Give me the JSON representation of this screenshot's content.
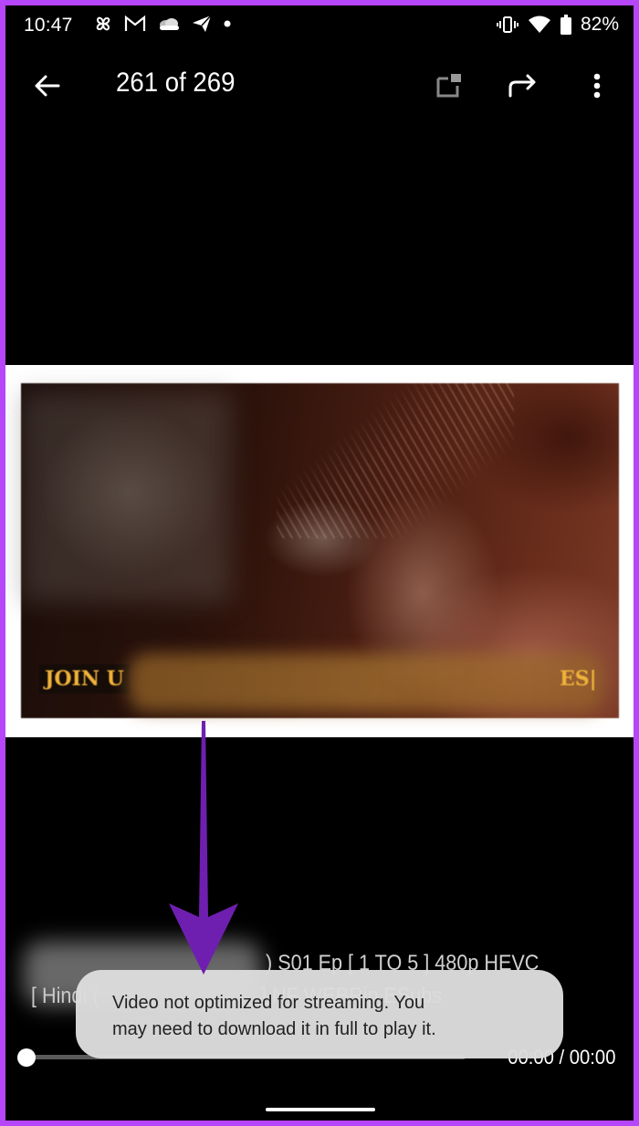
{
  "status_bar": {
    "time": "10:47",
    "notification_icons": [
      "pinwheel-icon",
      "gmail-icon",
      "onedrive-cloud-icon",
      "telegram-icon",
      "more-notifications-dot-icon"
    ],
    "system_icons": [
      "vibrate-icon",
      "wifi-icon",
      "battery-icon"
    ],
    "battery_percent": "82%"
  },
  "toolbar": {
    "back_icon": "arrow-left-icon",
    "counter": "261 of 269",
    "actions": [
      "picture-in-picture-icon",
      "share-icon",
      "more-vert-icon"
    ]
  },
  "media": {
    "banner_start": "JOIN U",
    "banner_end": "ES|"
  },
  "subtitles": {
    "line1": ") S01 Ep [ 1 TO 5 ] 480p HEVC",
    "line2_start": "[ Hindi (",
    "line2_mid": "] NF WEBRip ESubs"
  },
  "player": {
    "progress": 0,
    "time_readout": "00:00 / 00:00"
  },
  "toast": {
    "line1": "Video not optimized for streaming. You",
    "line2": "may need to download it in full to play it."
  },
  "annotation": {
    "arrow_color": "#6f1fb0",
    "frame_color": "#b646f9"
  }
}
